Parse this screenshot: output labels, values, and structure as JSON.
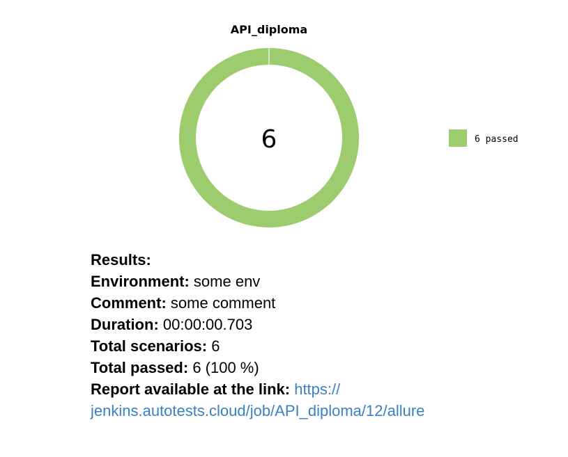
{
  "chart_data": {
    "type": "pie",
    "title": "API_diploma",
    "center_label": "6",
    "categories": [
      "passed"
    ],
    "values": [
      6
    ],
    "legend": [
      {
        "label": "6 passed",
        "color": "#9ccc6e"
      }
    ],
    "legend_position": "right",
    "colors": {
      "passed": "#9ccc6e"
    }
  },
  "results": {
    "heading": "Results:",
    "environment_label": "Environment:",
    "environment_value": "some env",
    "comment_label": "Comment:",
    "comment_value": "some comment",
    "duration_label": "Duration:",
    "duration_value": "00:00:00.703",
    "total_scenarios_label": "Total scenarios:",
    "total_scenarios_value": "6",
    "total_passed_label": "Total passed:",
    "total_passed_value": "6 (100 %)",
    "report_label": "Report available at the link:",
    "report_link_part1": "https://",
    "report_link_part2": "jenkins.autotests.cloud/job/API_diploma/12/allure"
  }
}
